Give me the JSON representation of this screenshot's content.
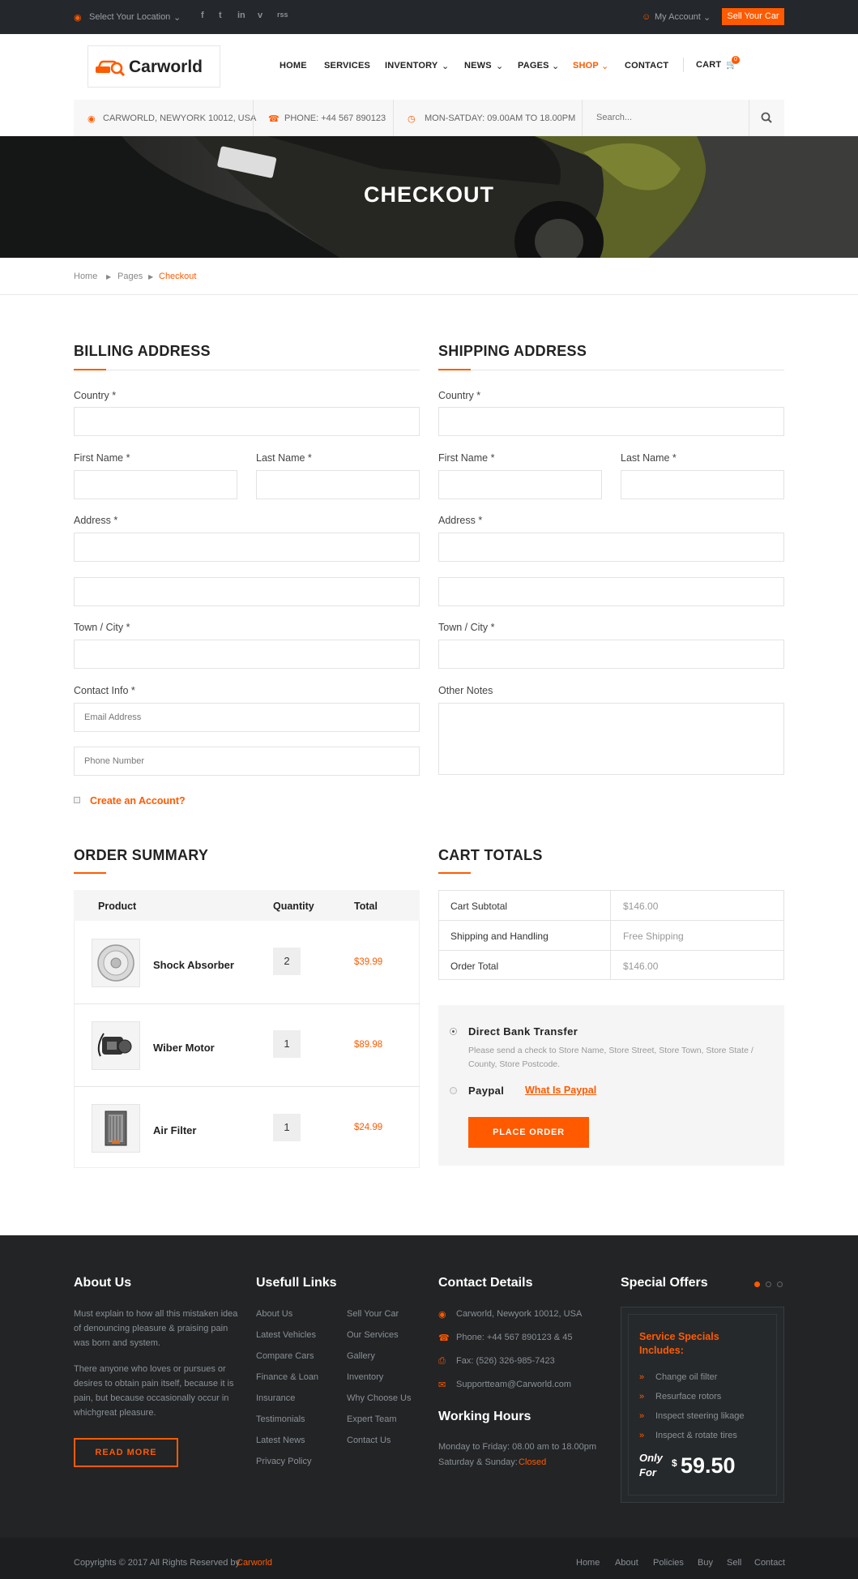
{
  "topbar": {
    "location": "Select Your Location",
    "account": "My Account",
    "sell": "Sell Your Car",
    "social": [
      "f",
      "t",
      "in",
      "v",
      "rss"
    ]
  },
  "header": {
    "logo": "Carworld",
    "nav": [
      "HOME",
      "SERVICES",
      "INVENTORY",
      "NEWS",
      "PAGES",
      "SHOP",
      "CONTACT"
    ],
    "cart_label": "CART",
    "cart_count": "0"
  },
  "infobar": {
    "address": "CARWORLD, NEWYORK 10012, USA",
    "phone": "PHONE: +44 567 890123",
    "hours": "MON-SATDAY: 09.00AM TO 18.00PM",
    "search_placeholder": "Search..."
  },
  "hero": {
    "title": "CHECKOUT"
  },
  "breadcrumb": [
    "Home",
    "Pages",
    "Checkout"
  ],
  "billing": {
    "heading": "BILLING ADDRESS",
    "country": "Country *",
    "first_name": "First Name *",
    "last_name": "Last Name *",
    "address": "Address *",
    "town": "Town / City *",
    "contact": "Contact Info *",
    "email_placeholder": "Email Address",
    "phone_placeholder": "Phone Number",
    "create_account": "Create an Account?"
  },
  "shipping": {
    "heading": "SHIPPING ADDRESS",
    "country": "Country *",
    "first_name": "First Name *",
    "last_name": "Last Name *",
    "address": "Address *",
    "town": "Town / City *",
    "notes": "Other Notes"
  },
  "order_summary": {
    "heading": "ORDER SUMMARY",
    "columns": [
      "Product",
      "Quantity",
      "Total"
    ],
    "rows": [
      {
        "name": "Shock Absorber",
        "qty": "2",
        "total": "$39.99"
      },
      {
        "name": "Wiber Motor",
        "qty": "1",
        "total": "$89.98"
      },
      {
        "name": "Air Filter",
        "qty": "1",
        "total": "$24.99"
      }
    ]
  },
  "cart_totals": {
    "heading": "CART TOTALS",
    "rows": [
      {
        "label": "Cart Subtotal",
        "value": "$146.00"
      },
      {
        "label": "Shipping and Handling",
        "value": "Free Shipping"
      },
      {
        "label": "Order Total",
        "value": "$146.00"
      }
    ]
  },
  "payment": {
    "bank": "Direct Bank Transfer",
    "bank_desc": "Please send a check to Store Name, Store Street, Store Town, Store State / County, Store Postcode.",
    "paypal": "Paypal",
    "paypal_link": "What Is Paypal",
    "place_order": "PLACE ORDER"
  },
  "footer": {
    "about_heading": "About Us",
    "about_p1": "Must explain to how all this mistaken idea of denouncing pleasure & praising pain was born and system.",
    "about_p2": "There anyone who loves or pursues or desires to obtain pain itself, because it is pain, but because occasionally occur in whichgreat pleasure.",
    "read_more": "READ MORE",
    "links_heading": "Usefull Links",
    "links_col1": [
      "About Us",
      "Latest Vehicles",
      "Compare Cars",
      "Finance & Loan",
      "Insurance",
      "Testimonials",
      "Latest News",
      "Privacy Policy"
    ],
    "links_col2": [
      "Sell Your Car",
      "Our Services",
      "Gallery",
      "Inventory",
      "Why Choose Us",
      "Expert Team",
      "Contact Us"
    ],
    "contact_heading": "Contact Details",
    "contact": [
      "Carworld, Newyork 10012, USA",
      "Phone: +44 567 890123 & 45",
      "Fax: (526) 326-985-7423",
      "Supportteam@Carworld.com"
    ],
    "hours_heading": "Working Hours",
    "hours_weekday": "Monday to Friday: 08.00 am to 18.00pm",
    "hours_weekend": "Saturday & Sunday:",
    "hours_closed": "Closed",
    "offers_heading": "Special Offers",
    "offer_title": "Service Specials Includes:",
    "offer_items": [
      "Change oil filter",
      "Resurface rotors",
      "Inspect steering likage",
      "Inspect & rotate tires"
    ],
    "offer_only": "Only",
    "offer_for": "For",
    "offer_currency": "$",
    "offer_price": "59.50",
    "copyright": "Copyrights © 2017 All Rights Reserved by",
    "copyright_brand": "Carworld",
    "bottom_links": [
      "Home",
      "About",
      "Policies",
      "Buy",
      "Sell",
      "Contact"
    ]
  },
  "colors": {
    "accent": "#ff5a00",
    "dark": "#24272b"
  }
}
